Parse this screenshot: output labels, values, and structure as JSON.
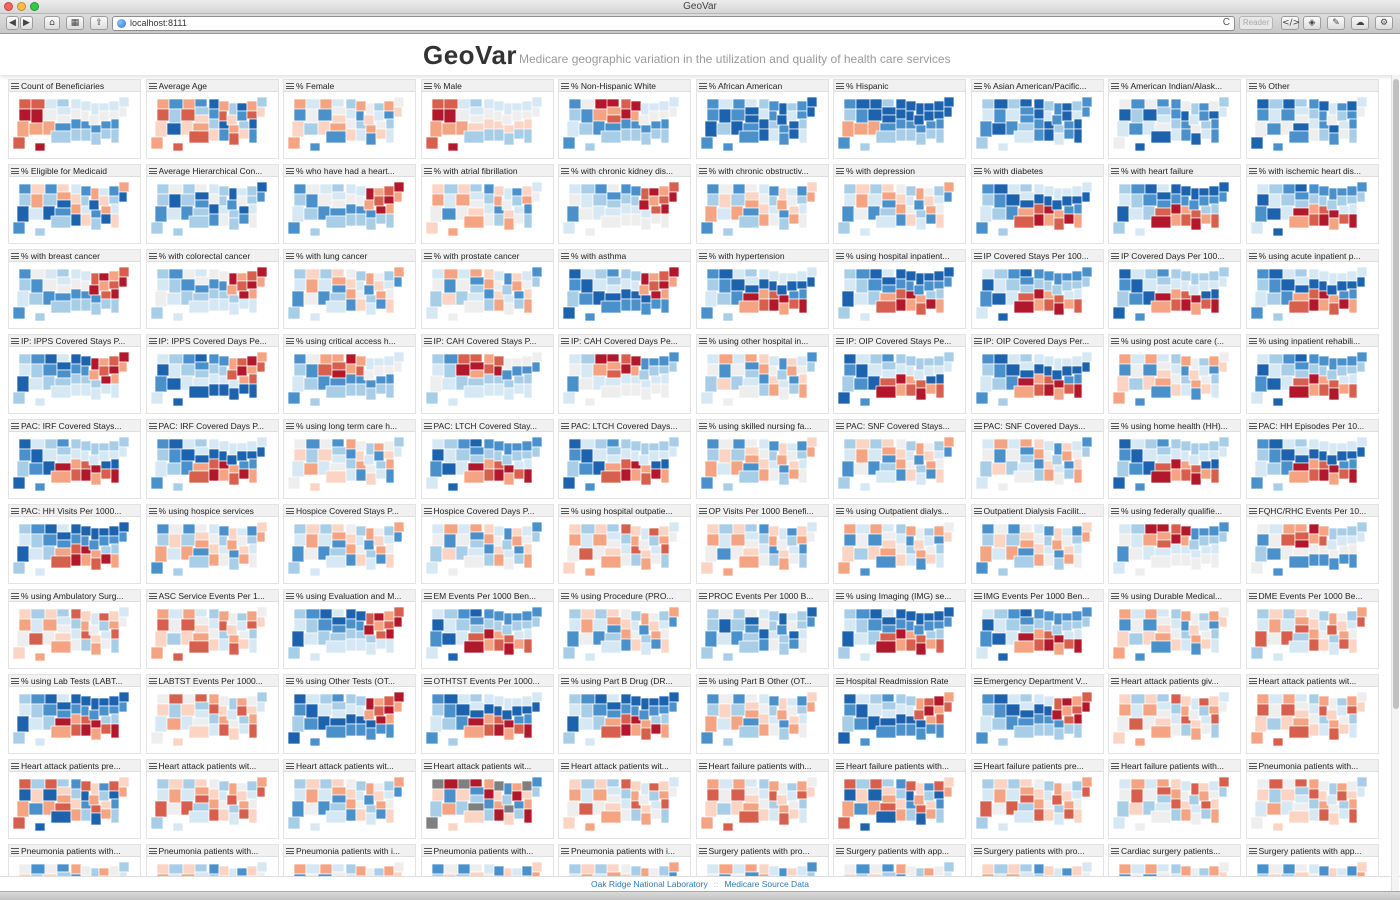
{
  "window": {
    "title": "GeoVar"
  },
  "browser": {
    "url": "localhost:8111",
    "reader_label": "Reader",
    "nav_back": "◀",
    "nav_forward": "▶",
    "reload": "C"
  },
  "app": {
    "name": "GeoVar",
    "subtitle": "Medicare geographic variation in the utilization and quality of health care services"
  },
  "colors": {
    "dark_blue": "#1c62ad",
    "mid_blue": "#4a91cc",
    "light_blue": "#a8cde6",
    "pale_blue": "#d6e8f4",
    "neutral": "#eeeeee",
    "pale_red": "#fbd4c4",
    "light_red": "#f4a482",
    "mid_red": "#d6604d",
    "dark_red": "#b2182b",
    "missing_gray": "#7f7f7f"
  },
  "panels": [
    {
      "title": "Count of Beneficiaries",
      "scheme": "mixed-red-west"
    },
    {
      "title": "Average Age",
      "scheme": "mixed"
    },
    {
      "title": "% Female",
      "scheme": "light-mixed"
    },
    {
      "title": "% Male",
      "scheme": "red-west"
    },
    {
      "title": "% Non-Hispanic White",
      "scheme": "red-center"
    },
    {
      "title": "% African American",
      "scheme": "blue"
    },
    {
      "title": "% Hispanic",
      "scheme": "blue-red-sw"
    },
    {
      "title": "% Asian American/Pacific...",
      "scheme": "blue"
    },
    {
      "title": "% American Indian/Alask...",
      "scheme": "blue-gray"
    },
    {
      "title": "% Other",
      "scheme": "blue-gray"
    },
    {
      "title": "% Eligible for Medicaid",
      "scheme": "blue-mixed"
    },
    {
      "title": "Average Hierarchical Con...",
      "scheme": "blue-light"
    },
    {
      "title": "% who have had a heart...",
      "scheme": "mixed-red-east"
    },
    {
      "title": "% with atrial fibrillation",
      "scheme": "light-mixed"
    },
    {
      "title": "% with chronic kidney dis...",
      "scheme": "mixed-red-east"
    },
    {
      "title": "% with chronic obstructiv...",
      "scheme": "light-mixed"
    },
    {
      "title": "% with depression",
      "scheme": "light-mixed"
    },
    {
      "title": "% with diabetes",
      "scheme": "blue-red-south"
    },
    {
      "title": "% with heart failure",
      "scheme": "blue-red-south"
    },
    {
      "title": "% with ischemic heart dis...",
      "scheme": "blue-red-south"
    },
    {
      "title": "% with breast cancer",
      "scheme": "mixed-red-east"
    },
    {
      "title": "% with colorectal cancer",
      "scheme": "mixed-red-east"
    },
    {
      "title": "% with lung cancer",
      "scheme": "light-mixed"
    },
    {
      "title": "% with prostate cancer",
      "scheme": "light-mixed"
    },
    {
      "title": "% with asthma",
      "scheme": "blue-red-east"
    },
    {
      "title": "% with hypertension",
      "scheme": "blue-red-south"
    },
    {
      "title": "% using hospital inpatient...",
      "scheme": "blue-red-south"
    },
    {
      "title": "IP Covered Stays Per 100...",
      "scheme": "blue-red-south"
    },
    {
      "title": "IP Covered Days Per 100...",
      "scheme": "blue-red-south"
    },
    {
      "title": "% using acute inpatient p...",
      "scheme": "blue-red-south"
    },
    {
      "title": "IP: IPPS Covered Stays P...",
      "scheme": "blue-red-east"
    },
    {
      "title": "IP: IPPS Covered Days Pe...",
      "scheme": "blue-red-east"
    },
    {
      "title": "% using critical access h...",
      "scheme": "red-center"
    },
    {
      "title": "IP: CAH Covered Stays P...",
      "scheme": "red-center"
    },
    {
      "title": "IP: CAH Covered Days Pe...",
      "scheme": "red-center"
    },
    {
      "title": "% using other hospital in...",
      "scheme": "light-mixed"
    },
    {
      "title": "IP: OIP Covered Stays Pe...",
      "scheme": "blue-red-south"
    },
    {
      "title": "IP: OIP Covered Days Per...",
      "scheme": "blue-red-south"
    },
    {
      "title": "% using post acute care (...",
      "scheme": "light-mixed"
    },
    {
      "title": "% using inpatient rehabili...",
      "scheme": "blue-red-south"
    },
    {
      "title": "PAC: IRF Covered Stays...",
      "scheme": "blue-red-south"
    },
    {
      "title": "PAC: IRF Covered Days P...",
      "scheme": "blue-red-south"
    },
    {
      "title": "% using long term care h...",
      "scheme": "light-mixed"
    },
    {
      "title": "PAC: LTCH Covered Stay...",
      "scheme": "blue-red-south"
    },
    {
      "title": "PAC: LTCH Covered Days...",
      "scheme": "blue-red-south"
    },
    {
      "title": "% using skilled nursing fa...",
      "scheme": "light-mixed"
    },
    {
      "title": "PAC: SNF Covered Stays...",
      "scheme": "light-mixed"
    },
    {
      "title": "PAC: SNF Covered Days...",
      "scheme": "light-mixed"
    },
    {
      "title": "% using home health (HH)...",
      "scheme": "blue-red-south"
    },
    {
      "title": "PAC: HH Episodes Per 10...",
      "scheme": "blue-red-south"
    },
    {
      "title": "PAC: HH Visits Per 1000...",
      "scheme": "blue-red-south"
    },
    {
      "title": "% using hospice services",
      "scheme": "light-mixed"
    },
    {
      "title": "Hospice Covered Stays P...",
      "scheme": "light-mixed"
    },
    {
      "title": "Hospice Covered Days P...",
      "scheme": "light-mixed"
    },
    {
      "title": "% using hospital outpatie...",
      "scheme": "red-light"
    },
    {
      "title": "OP Visits Per 1000 Benefi...",
      "scheme": "light-mixed"
    },
    {
      "title": "% using Outpatient dialys...",
      "scheme": "light-mixed"
    },
    {
      "title": "Outpatient Dialysis Facilit...",
      "scheme": "light-mixed"
    },
    {
      "title": "% using federally qualifie...",
      "scheme": "red-center"
    },
    {
      "title": "FQHC/RHC Events Per 10...",
      "scheme": "red-center"
    },
    {
      "title": "% using Ambulatory Surg...",
      "scheme": "red-light"
    },
    {
      "title": "ASC Service Events Per 1...",
      "scheme": "red-light"
    },
    {
      "title": "% using Evaluation and M...",
      "scheme": "blue-red-east"
    },
    {
      "title": "EM Events Per 1000 Ben...",
      "scheme": "blue-red-south"
    },
    {
      "title": "% using Procedure (PRO...",
      "scheme": "light-mixed"
    },
    {
      "title": "PROC Events Per 1000 B...",
      "scheme": "blue-light"
    },
    {
      "title": "% using Imaging (IMG) se...",
      "scheme": "blue-red-south"
    },
    {
      "title": "IMG Events Per 1000 Ben...",
      "scheme": "blue-red-south"
    },
    {
      "title": "% using Durable Medical...",
      "scheme": "light-mixed"
    },
    {
      "title": "DME Events Per 1000 Be...",
      "scheme": "red-light"
    },
    {
      "title": "% using Lab Tests (LABT...",
      "scheme": "blue-red-south"
    },
    {
      "title": "LABTST Events Per 1000...",
      "scheme": "red-light"
    },
    {
      "title": "% using Other Tests (OT...",
      "scheme": "blue-red-east"
    },
    {
      "title": "OTHTST Events Per 1000...",
      "scheme": "blue-red-south"
    },
    {
      "title": "% using Part B Drug (DR...",
      "scheme": "blue-red-south"
    },
    {
      "title": "% using Part B Other (OT...",
      "scheme": "light-mixed"
    },
    {
      "title": "Hospital Readmission Rate",
      "scheme": "blue-red-east"
    },
    {
      "title": "Emergency Department V...",
      "scheme": "blue-red-east"
    },
    {
      "title": "Heart attack patients giv...",
      "scheme": "red-light"
    },
    {
      "title": "Heart attack patients wit...",
      "scheme": "red-light"
    },
    {
      "title": "Heart attack patients pre...",
      "scheme": "mixed"
    },
    {
      "title": "Heart attack patients wit...",
      "scheme": "red-light"
    },
    {
      "title": "Heart attack patients wit...",
      "scheme": "light-mixed"
    },
    {
      "title": "Heart attack patients wit...",
      "scheme": "gray-mixed"
    },
    {
      "title": "Heart attack patients wit...",
      "scheme": "red-light"
    },
    {
      "title": "Heart failure patients with...",
      "scheme": "red-light"
    },
    {
      "title": "Heart failure patients with...",
      "scheme": "mixed"
    },
    {
      "title": "Heart failure patients pre...",
      "scheme": "red-light"
    },
    {
      "title": "Heart failure patients with...",
      "scheme": "red-light"
    },
    {
      "title": "Pneumonia patients with...",
      "scheme": "red-light"
    },
    {
      "title": "Pneumonia patients with...",
      "scheme": "light-mixed"
    },
    {
      "title": "Pneumonia patients with...",
      "scheme": "light-mixed"
    },
    {
      "title": "Pneumonia patients with i...",
      "scheme": "light-mixed"
    },
    {
      "title": "Pneumonia patients with...",
      "scheme": "light-mixed"
    },
    {
      "title": "Pneumonia patients with i...",
      "scheme": "light-mixed"
    },
    {
      "title": "Surgery patients with pro...",
      "scheme": "light-mixed"
    },
    {
      "title": "Surgery patients with app...",
      "scheme": "light-mixed"
    },
    {
      "title": "Surgery patients with pro...",
      "scheme": "light-mixed"
    },
    {
      "title": "Cardiac surgery patients...",
      "scheme": "light-mixed"
    },
    {
      "title": "Surgery patients with app...",
      "scheme": "light-mixed"
    }
  ],
  "footer": {
    "link1": "Oak Ridge National Laboratory",
    "separator": "::",
    "link2": "Medicare Source Data"
  }
}
